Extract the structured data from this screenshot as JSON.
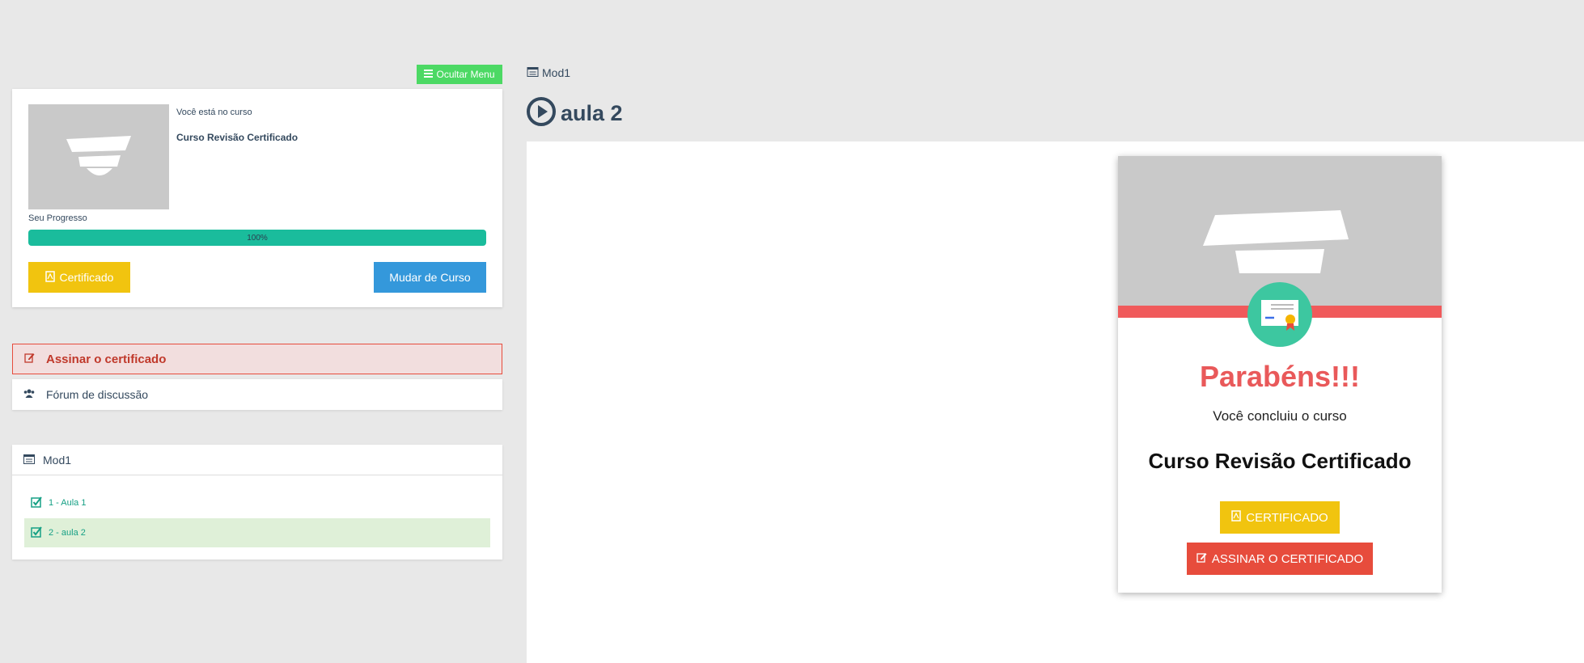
{
  "sidebar": {
    "toggle_label": "Ocultar Menu",
    "course_intro": "Você está no curso",
    "course_name": "Curso Revisão Certificado",
    "progress_label": "Seu Progresso",
    "progress_value": 100,
    "progress_text": "100%",
    "cert_button": "Certificado",
    "change_course_button": "Mudar de Curso",
    "sign_certificate": "Assinar o certificado",
    "forum": "Fórum de discussão",
    "module": {
      "title": "Mod1",
      "lessons": [
        {
          "label": "1 - Aula 1",
          "completed": true,
          "active": false
        },
        {
          "label": "2 - aula 2",
          "completed": true,
          "active": true
        }
      ]
    }
  },
  "main": {
    "breadcrumb": "Mod1",
    "lesson_title": "aula 2"
  },
  "completion_card": {
    "title": "Parabéns!!!",
    "subtitle": "Você concluiu o curso",
    "course_name": "Curso Revisão Certificado",
    "cert_button": "CERTIFICADO",
    "sign_button": "ASSINAR O CERTIFICADO"
  },
  "colors": {
    "accent_green": "#4cd964",
    "progress": "#1abc9c",
    "yellow": "#f1c40f",
    "blue": "#3498db",
    "red": "#e74c3c",
    "congrats_red": "#e9595a",
    "badge_green": "#3dc7a0"
  },
  "icons": {
    "toggle": "bars-icon",
    "pdf": "file-pdf-icon",
    "edit": "edit-icon",
    "forum": "users-icon",
    "module": "list-alt-icon",
    "check": "check-square-icon",
    "play": "play-circle-icon",
    "badge": "certificate-icon"
  }
}
